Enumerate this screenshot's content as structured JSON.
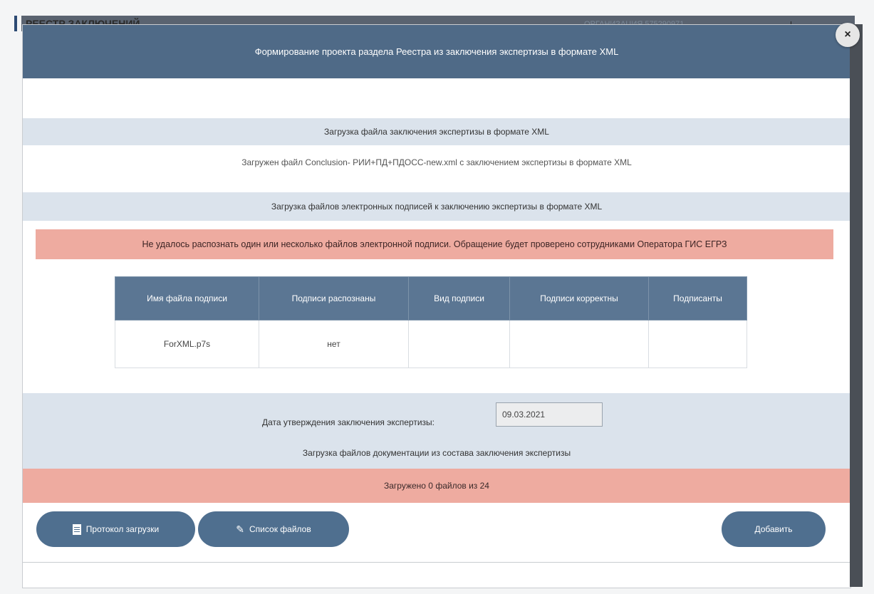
{
  "backdrop": {
    "title": "РЕЕСТР ЗАКЛЮЧЕНИЙ",
    "organization": "ОРГАНИЗАЦИЯ 575290971"
  },
  "modal": {
    "title": "Формирование проекта раздела Реестра из заключения экспертизы в формате XML",
    "close_glyph": "×",
    "xml_section_title": "Загрузка файла заключения экспертизы в формате XML",
    "xml_loaded_text": "Загружен файл Conclusion- РИИ+ПД+ПДОСС-new.xml с заключением экспертизы в формате XML",
    "signatures_section_title": "Загрузка файлов электронных подписей к заключению экспертизы в формате XML",
    "signature_error": "Не удалось распознать один или несколько файлов электронной подписи. Обращение будет проверено сотрудниками Оператора ГИС ЕГРЗ",
    "table": {
      "headers": [
        "Имя файла подписи",
        "Подписи распознаны",
        "Вид подписи",
        "Подписи корректны",
        "Подписанты"
      ],
      "rows": [
        [
          "ForXML.p7s",
          "нет",
          "",
          "",
          ""
        ]
      ]
    },
    "approval_date_label": "Дата утверждения заключения экспертизы:",
    "approval_date_value": "09.03.2021",
    "docs_section_title": "Загрузка файлов документации из состава заключения экспертизы",
    "upload_progress": "Загружено 0 файлов из 24"
  },
  "buttons": {
    "protocol": "Протокол загрузки",
    "file_list": "Список файлов",
    "add": "Добавить"
  },
  "colors": {
    "header_bg": "#4f6a87",
    "band_bg": "#dbe3ec",
    "alert_bg": "#eeaba0",
    "button_bg": "#4f6f8f",
    "table_header_bg": "#5b7693"
  }
}
